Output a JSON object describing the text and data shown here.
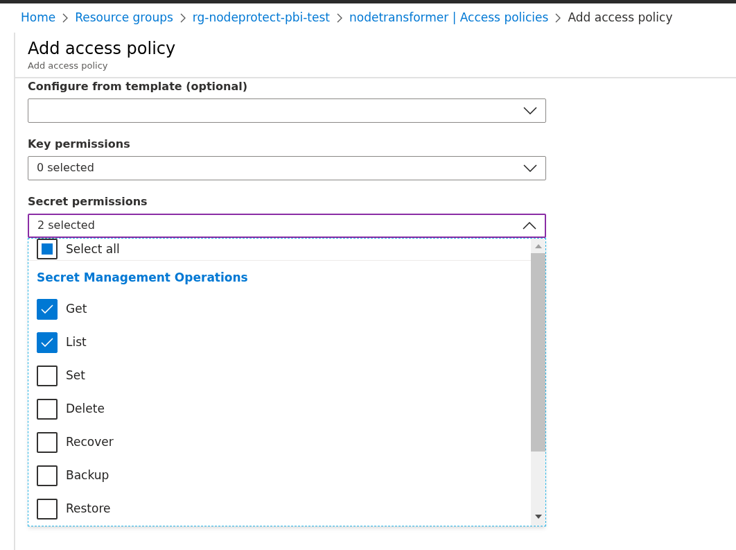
{
  "breadcrumb": [
    {
      "label": "Home",
      "link": true
    },
    {
      "label": "Resource groups",
      "link": true
    },
    {
      "label": "rg-nodeprotect-pbi-test",
      "link": true
    },
    {
      "label": "nodetransformer | Access policies",
      "link": true
    },
    {
      "label": "Add access policy",
      "link": false
    }
  ],
  "panel": {
    "title": "Add access policy",
    "subtitle": "Add access policy"
  },
  "fields": [
    {
      "label": "Configure from template (optional)",
      "expanded": false
    },
    {
      "label": "Key permissions",
      "value": "0 selected",
      "expanded": false
    },
    {
      "label": "Secret permissions",
      "value": "2 selected",
      "expanded": true
    }
  ],
  "dropdown": {
    "select_all": {
      "label": "Select all",
      "indeterminate": true
    },
    "group": "Secret Management Operations",
    "options": [
      {
        "label": "Get",
        "checked": true
      },
      {
        "label": "List",
        "checked": true
      },
      {
        "label": "Set",
        "checked": false
      },
      {
        "label": "Delete",
        "checked": false
      },
      {
        "label": "Recover",
        "checked": false
      },
      {
        "label": "Backup",
        "checked": false
      },
      {
        "label": "Restore",
        "checked": false
      }
    ]
  }
}
